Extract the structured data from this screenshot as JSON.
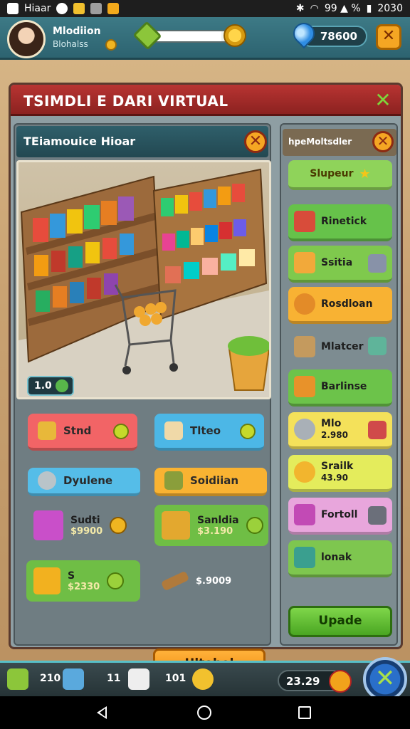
{
  "status_bar": {
    "app_label": "Hiaar",
    "signal_text": "99 ▲ %",
    "clock": "2030"
  },
  "hud": {
    "player_name": "Mlodiion",
    "player_subtitle": "Blohalss",
    "gem_balance": "78600",
    "xp_progress": 0.9
  },
  "main_window": {
    "title": "TSIMDLI E DARI VIRTUAL"
  },
  "shop_panel": {
    "title": "TEiamouice Hioar",
    "level_badge": "1.0",
    "buttons": [
      {
        "label": "Stnd",
        "color": "#f26466"
      },
      {
        "label": "Tlteo",
        "color": "#4cb7e6"
      },
      {
        "label": "Dyulene",
        "color": "#55bde8"
      },
      {
        "label": "Soidiian",
        "color": "#f9b332"
      }
    ],
    "items": [
      {
        "title": "Sudti",
        "price": "$9900"
      },
      {
        "title": "Sanldia",
        "price": "$3.190"
      },
      {
        "title": "S",
        "price": "$2330"
      },
      {
        "title": "",
        "price": "$.9009"
      }
    ],
    "unlock_label": "Ultohel"
  },
  "side_panel": {
    "title": "hpeMoltsdler",
    "highlight": "Slupeur",
    "items": [
      {
        "label": "Rinetick",
        "sub": "",
        "color": "#66c24a"
      },
      {
        "label": "Ssitia",
        "sub": "",
        "color": "#7fc94d"
      },
      {
        "label": "Rosdloan",
        "sub": "",
        "color": "#f8b233"
      },
      {
        "label": "Mlatcer",
        "sub": "",
        "color": "transparent"
      },
      {
        "label": "Barlinse",
        "sub": "",
        "color": "#6cc34a"
      },
      {
        "label": "Mlo",
        "sub": "2.980",
        "color": "#f4e15a"
      },
      {
        "label": "Srailk",
        "sub": "43.90",
        "color": "#e4ec5c"
      },
      {
        "label": "Fortoll",
        "sub": "",
        "color": "#e8a6dc"
      },
      {
        "label": "lonak",
        "sub": "",
        "color": "#7ec64f"
      }
    ],
    "upgrade_label": "Upade"
  },
  "bottom_bar": {
    "stat_1": "210",
    "stat_2": "11",
    "stat_3": "101",
    "money": "23.29"
  }
}
